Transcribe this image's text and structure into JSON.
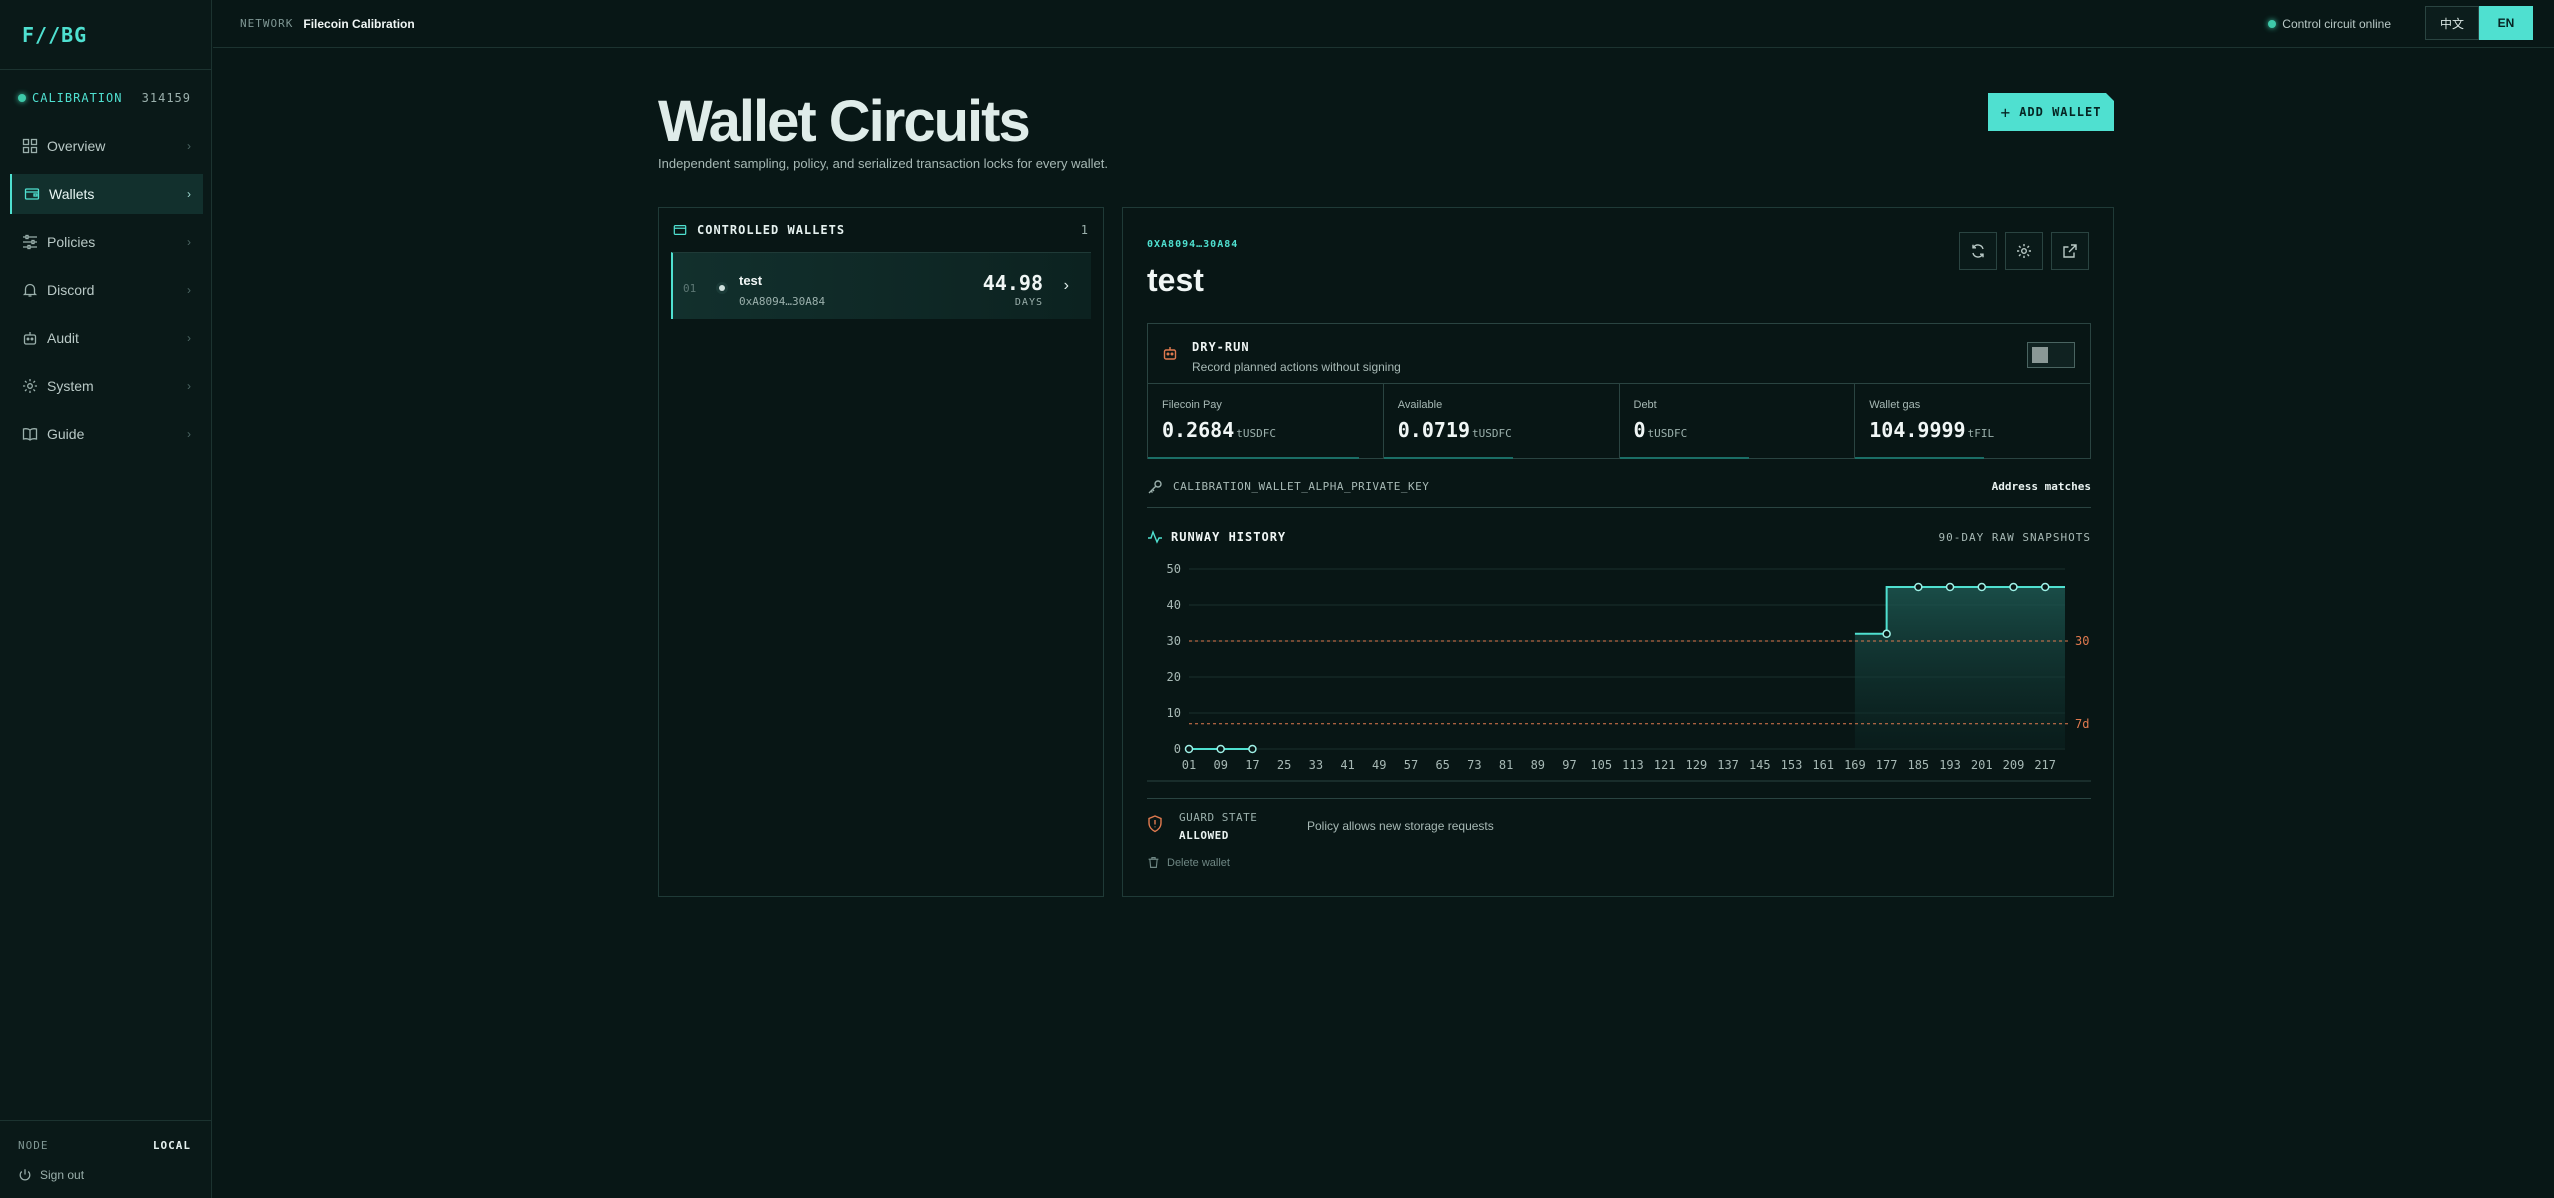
{
  "app": {
    "logo": "F//BG"
  },
  "sidebar": {
    "network_badge": "CALIBRATION",
    "block_number": "314159",
    "items": [
      {
        "label": "Overview",
        "icon": "grid-icon"
      },
      {
        "label": "Wallets",
        "icon": "wallet-icon",
        "active": true
      },
      {
        "label": "Policies",
        "icon": "sliders-icon"
      },
      {
        "label": "Discord",
        "icon": "bell-icon"
      },
      {
        "label": "Audit",
        "icon": "robot-icon"
      },
      {
        "label": "System",
        "icon": "gear-icon"
      },
      {
        "label": "Guide",
        "icon": "book-icon"
      }
    ],
    "footer": {
      "node_label": "NODE",
      "node_value": "LOCAL",
      "sign_out": "Sign out"
    }
  },
  "topbar": {
    "network_label": "NETWORK",
    "network_name": "Filecoin Calibration",
    "status": "Control circuit online",
    "lang_zh": "中文",
    "lang_en": "EN"
  },
  "page": {
    "title": "Wallet Circuits",
    "subtitle": "Independent sampling, policy, and serialized transaction locks for every wallet.",
    "add_button": "ADD WALLET"
  },
  "wallet_list": {
    "title": "CONTROLLED WALLETS",
    "count": "1",
    "rows": [
      {
        "index": "01",
        "name": "test",
        "address": "0xA8094…30A84",
        "days": "44.98",
        "days_label": "DAYS"
      }
    ]
  },
  "detail": {
    "address": "0XA8094…30A84",
    "name": "test",
    "dry_run": {
      "title": "DRY-RUN",
      "subtitle": "Record planned actions without signing",
      "enabled": false
    },
    "stats": [
      {
        "label": "Filecoin Pay",
        "value": "0.2684",
        "unit": "tUSDFC",
        "fill": 0.9
      },
      {
        "label": "Available",
        "value": "0.0719",
        "unit": "tUSDFC",
        "fill": 0.55
      },
      {
        "label": "Debt",
        "value": "0",
        "unit": "tUSDFC",
        "fill": 0.55
      },
      {
        "label": "Wallet gas",
        "value": "104.9999",
        "unit": "tFIL",
        "fill": 0.55
      }
    ],
    "key_name": "CALIBRATION_WALLET_ALPHA_PRIVATE_KEY",
    "key_status": "Address matches",
    "history_title": "RUNWAY HISTORY",
    "history_range": "90-DAY RAW SNAPSHOTS",
    "guard_label": "GUARD STATE",
    "guard_value": "ALLOWED",
    "guard_message": "Policy allows new storage requests",
    "delete_label": "Delete wallet"
  },
  "chart_data": {
    "type": "line",
    "y_ticks": [
      0,
      10,
      20,
      30,
      40,
      50
    ],
    "ylim": [
      0,
      50
    ],
    "x_ticks": [
      "01",
      "09",
      "17",
      "25",
      "33",
      "41",
      "49",
      "57",
      "65",
      "73",
      "81",
      "89",
      "97",
      "105",
      "113",
      "121",
      "129",
      "137",
      "145",
      "153",
      "161",
      "169",
      "177",
      "185",
      "193",
      "201",
      "209",
      "217"
    ],
    "xlim": [
      1,
      222
    ],
    "thresholds": [
      {
        "value": 30,
        "label": "30"
      },
      {
        "value": 7,
        "label": "7d"
      }
    ],
    "series": [
      {
        "points": [
          [
            1,
            0
          ],
          [
            9,
            0
          ],
          [
            17,
            0
          ]
        ]
      },
      {
        "points": [
          [
            169,
            32
          ],
          [
            177,
            32
          ],
          [
            177,
            45
          ],
          [
            185,
            45
          ],
          [
            193,
            45
          ],
          [
            201,
            45
          ],
          [
            209,
            45
          ],
          [
            217,
            45
          ],
          [
            222,
            45
          ]
        ]
      }
    ],
    "markers": [
      [
        1,
        0
      ],
      [
        9,
        0
      ],
      [
        17,
        0
      ],
      [
        177,
        32
      ],
      [
        185,
        45
      ],
      [
        193,
        45
      ],
      [
        201,
        45
      ],
      [
        209,
        45
      ],
      [
        217,
        45
      ]
    ]
  },
  "colors": {
    "accent": "#4fe0d0",
    "threshold": "#e07a4f",
    "background": "#081716"
  }
}
